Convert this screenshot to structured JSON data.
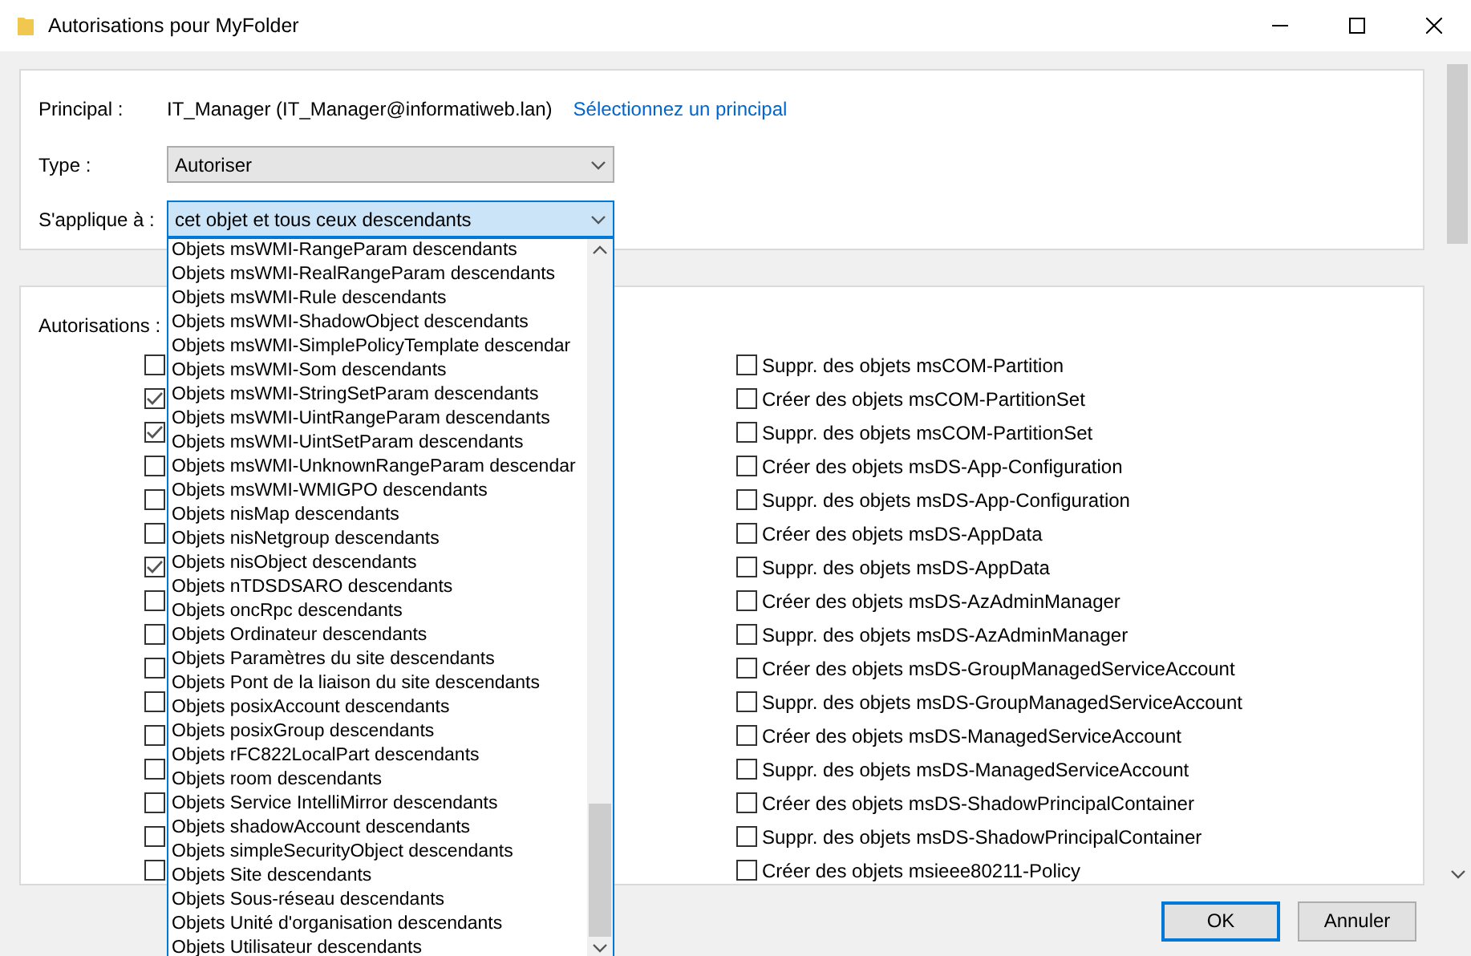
{
  "window": {
    "title": "Autorisations pour MyFolder"
  },
  "principal": {
    "label": "Principal :",
    "value": "IT_Manager (IT_Manager@informatiweb.lan)",
    "link": "Sélectionnez un principal"
  },
  "type": {
    "label": "Type :",
    "value": "Autoriser"
  },
  "applies_to": {
    "label": "S'applique à :",
    "value": "cet objet et tous ceux descendants",
    "expanded": true,
    "options": [
      "Objets msWMI-RangeParam descendants",
      "Objets msWMI-RealRangeParam descendants",
      "Objets msWMI-Rule descendants",
      "Objets msWMI-ShadowObject descendants",
      "Objets msWMI-SimplePolicyTemplate descendar",
      "Objets msWMI-Som descendants",
      "Objets msWMI-StringSetParam descendants",
      "Objets msWMI-UintRangeParam descendants",
      "Objets msWMI-UintSetParam descendants",
      "Objets msWMI-UnknownRangeParam descendar",
      "Objets msWMI-WMIGPO descendants",
      "Objets nisMap descendants",
      "Objets nisNetgroup descendants",
      "Objets nisObject descendants",
      "Objets nTDSDSARO descendants",
      "Objets oncRpc descendants",
      "Objets Ordinateur descendants",
      "Objets Paramètres du site descendants",
      "Objets Pont de la liaison du site descendants",
      "Objets posixAccount descendants",
      "Objets posixGroup descendants",
      "Objets rFC822LocalPart descendants",
      "Objets room descendants",
      "Objets Service IntelliMirror descendants",
      "Objets shadowAccount descendants",
      "Objets simpleSecurityObject descendants",
      "Objets Site descendants",
      "Objets Sous-réseau  descendants",
      "Objets Unité d'organisation  descendants",
      "Objets Utilisateur descendants"
    ]
  },
  "permissions": {
    "label": "Autorisations :",
    "left_column": [
      {
        "checked": false
      },
      {
        "checked": true
      },
      {
        "checked": true
      },
      {
        "checked": false
      },
      {
        "checked": false
      },
      {
        "checked": false
      },
      {
        "checked": true
      },
      {
        "checked": false
      },
      {
        "checked": false
      },
      {
        "checked": false
      },
      {
        "checked": false
      },
      {
        "checked": false
      },
      {
        "checked": false
      },
      {
        "checked": false
      },
      {
        "checked": false
      },
      {
        "checked": false
      }
    ],
    "right_column": [
      {
        "label": "Suppr. des objets msCOM-Partition",
        "checked": false
      },
      {
        "label": "Créer des objets msCOM-PartitionSet",
        "checked": false
      },
      {
        "label": "Suppr. des objets msCOM-PartitionSet",
        "checked": false
      },
      {
        "label": "Créer des objets msDS-App-Configuration",
        "checked": false
      },
      {
        "label": "Suppr. des objets msDS-App-Configuration",
        "checked": false
      },
      {
        "label": "Créer des objets msDS-AppData",
        "checked": false
      },
      {
        "label": "Suppr. des objets msDS-AppData",
        "checked": false
      },
      {
        "label": "Créer des objets msDS-AzAdminManager",
        "checked": false
      },
      {
        "label": "Suppr. des objets msDS-AzAdminManager",
        "checked": false
      },
      {
        "label": "Créer des objets msDS-GroupManagedServiceAccount",
        "checked": false
      },
      {
        "label": "Suppr. des objets msDS-GroupManagedServiceAccount",
        "checked": false
      },
      {
        "label": "Créer des objets msDS-ManagedServiceAccount",
        "checked": false
      },
      {
        "label": "Suppr. des objets msDS-ManagedServiceAccount",
        "checked": false
      },
      {
        "label": "Créer des objets msDS-ShadowPrincipalContainer",
        "checked": false
      },
      {
        "label": "Suppr. des objets msDS-ShadowPrincipalContainer",
        "checked": false
      },
      {
        "label": "Créer des objets msieee80211-Policy",
        "checked": false
      }
    ]
  },
  "buttons": [
    {
      "label": "OK",
      "default": true
    },
    {
      "label": "Annuler",
      "default": false
    }
  ]
}
